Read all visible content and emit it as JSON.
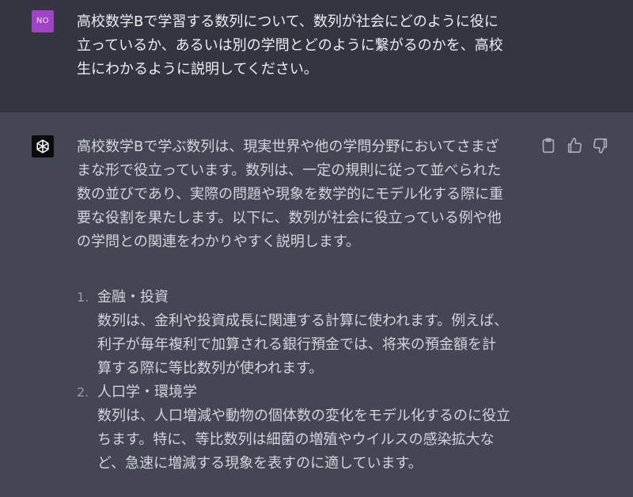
{
  "user_message": {
    "avatar_initials": "NO",
    "lines": [
      "高校数学Bで学習する数列について、数列が社会にどのように役に",
      "立っているか、あるいは別の学問とどのように繋がるのかを、高校",
      "生にわかるように説明してください。"
    ]
  },
  "assistant_message": {
    "avatar_icon": "openai-logo-icon",
    "intro_lines": [
      "高校数学Bで学ぶ数列は、現実世界や他の学問分野においてさまざ",
      "まな形で役立っています。数列は、一定の規則に従って並べられた",
      "数の並びであり、実際の問題や現象を数学的にモデル化する際に重",
      "要な役割を果たします。以下に、数列が社会に役立っている例や他",
      "の学問との関連をわかりやすく説明します。"
    ],
    "items": [
      {
        "number": "1.",
        "title": "金融・投資",
        "lines": [
          "数列は、金利や投資成長に関連する計算に使われます。例えば、",
          "利子が毎年複利で加算される銀行預金では、将来の預金額を計",
          "算する際に等比数列が使われます。"
        ]
      },
      {
        "number": "2.",
        "title": "人口学・環境学",
        "lines": [
          "数列は、人口増減や動物の個体数の変化をモデル化するのに役立",
          "ちます。特に、等比数列は細菌の増殖やウイルスの感染拡大な",
          "ど、急速に増減する現象を表すのに適しています。"
        ]
      }
    ],
    "actions": [
      "clipboard-icon",
      "thumbs-up-icon",
      "thumbs-down-icon"
    ]
  },
  "colors": {
    "user_bg": "#343541",
    "assistant_bg": "#444654",
    "user_avatar": "#a143c7",
    "text": "#d1d5db"
  }
}
